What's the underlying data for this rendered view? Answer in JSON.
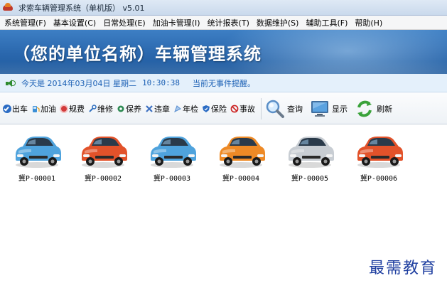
{
  "window": {
    "title": "求索车辆管理系统（单机版） v5.01"
  },
  "menubar": {
    "items": [
      "系统管理(F)",
      "基本设置(C)",
      "日常处理(E)",
      "加油卡管理(I)",
      "统计报表(T)",
      "数据维护(S)",
      "辅助工具(F)",
      "帮助(H)"
    ]
  },
  "banner": {
    "title": "（您的单位名称）车辆管理系统"
  },
  "infobar": {
    "date_text": "今天是 2014年03月04日 星期二",
    "time": "10:30:38",
    "alert": "当前无事件提醒。"
  },
  "toolbar": {
    "buttons": [
      {
        "label": "出车",
        "icon": "car-out-icon",
        "color": "#2b6cc4"
      },
      {
        "label": "加油",
        "icon": "fuel-icon",
        "color": "#3a8fd6"
      },
      {
        "label": "规费",
        "icon": "fee-icon",
        "color": "#d23b3b"
      },
      {
        "label": "维修",
        "icon": "repair-icon",
        "color": "#2f6fbf"
      },
      {
        "label": "保养",
        "icon": "maintenance-icon",
        "color": "#2d8a52"
      },
      {
        "label": "违章",
        "icon": "violation-icon",
        "color": "#3c6fc0"
      },
      {
        "label": "年检",
        "icon": "inspection-icon",
        "color": "#5a8fd0"
      },
      {
        "label": "保险",
        "icon": "insurance-icon",
        "color": "#2b6cc4"
      },
      {
        "label": "事故",
        "icon": "accident-icon",
        "color": "#cc2222"
      }
    ],
    "big_buttons": [
      {
        "label": "查询",
        "icon": "search-icon"
      },
      {
        "label": "显示",
        "icon": "monitor-icon"
      },
      {
        "label": "刷新",
        "icon": "refresh-icon"
      }
    ]
  },
  "vehicles": [
    {
      "plate": "冀P-00001",
      "color": "#4fa3dd"
    },
    {
      "plate": "冀P-00002",
      "color": "#e2522a"
    },
    {
      "plate": "冀P-00003",
      "color": "#4fa3dd"
    },
    {
      "plate": "冀P-00004",
      "color": "#ee8a26"
    },
    {
      "plate": "冀P-00005",
      "color": "#c8cdd3"
    },
    {
      "plate": "冀P-00006",
      "color": "#e2522a"
    }
  ],
  "watermark": "最需教育"
}
